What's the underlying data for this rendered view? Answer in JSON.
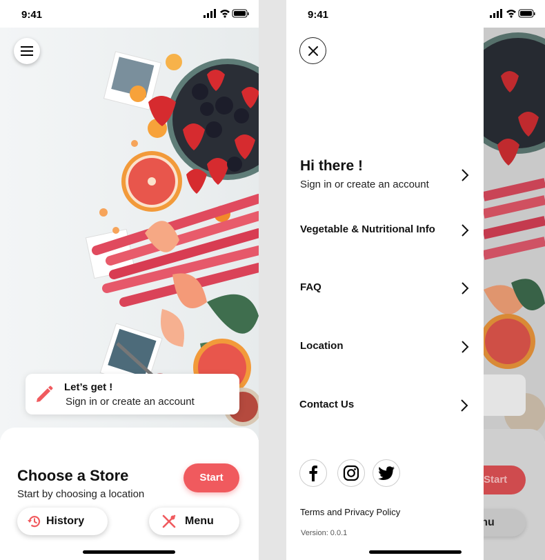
{
  "status_bar": {
    "time": "9:41"
  },
  "home": {
    "promo": {
      "title": "Let’s get !",
      "subtitle": "Sign in or create an account"
    },
    "sheet": {
      "title": "Choose a Store",
      "subtitle": "Start by choosing a location",
      "start_label": "Start",
      "history_label": "History",
      "menu_label": "Menu"
    }
  },
  "drawer": {
    "greeting": "Hi there !",
    "greeting_sub": "Sign in or create an account",
    "items": [
      {
        "label": "Vegetable & Nutritional Info"
      },
      {
        "label": "FAQ"
      },
      {
        "label": "Location"
      },
      {
        "label": "Contact Us"
      }
    ],
    "social": [
      "facebook-icon",
      "instagram-icon",
      "twitter-icon"
    ],
    "terms": "Terms and Privacy Policy",
    "version": "Version: 0.0.1"
  },
  "background": {
    "start_label": "Start",
    "menu_label": "Menu"
  },
  "colors": {
    "accent": "#f05a5e",
    "text": "#111111",
    "background": "#ffffff"
  }
}
